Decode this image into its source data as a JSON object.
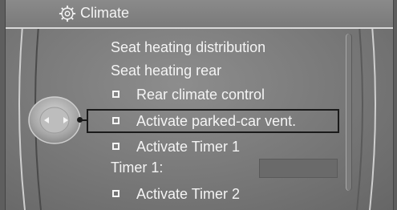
{
  "header": {
    "title": "Climate",
    "icon": "gear-icon"
  },
  "menu": {
    "items": [
      {
        "label": "Seat heating distribution",
        "checkbox": false
      },
      {
        "label": "Seat heating rear",
        "checkbox": false
      },
      {
        "label": "Rear climate control",
        "checkbox": true
      },
      {
        "label": "Activate parked-car vent.",
        "checkbox": true,
        "selected": true
      },
      {
        "label": "Activate Timer 1",
        "checkbox": true
      },
      {
        "label": "Timer 1:",
        "checkbox": false
      },
      {
        "label": "Activate Timer 2",
        "checkbox": true
      }
    ]
  },
  "controller": {
    "icon": "controller-knob-icon"
  },
  "colors": {
    "text": "#f4f4f4",
    "background": "#7c7c7c",
    "highlight_frame": "#1a1a1a"
  }
}
